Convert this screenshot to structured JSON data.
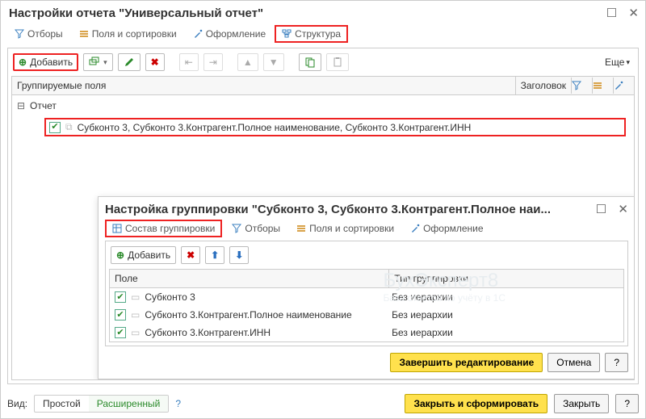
{
  "window": {
    "title": "Настройки отчета \"Универсальный отчет\"",
    "maximize_title": "Развернуть",
    "close_title": "Закрыть"
  },
  "tabs": {
    "filters": "Отборы",
    "fields": "Поля и сортировки",
    "style": "Оформление",
    "structure": "Структура"
  },
  "toolbar": {
    "add": "Добавить",
    "more": "Еще"
  },
  "columns": {
    "grouped_fields": "Группируемые поля",
    "header": "Заголовок"
  },
  "tree": {
    "root": "Отчет",
    "child": "Субконто 3, Субконто 3.Контрагент.Полное наименование, Субконто 3.Контрагент.ИНН"
  },
  "sub": {
    "title": "Настройка группировки \"Субконто 3, Субконто 3.Контрагент.Полное наи...",
    "tabs": {
      "composition": "Состав группировки",
      "filters": "Отборы",
      "fields": "Поля и сортировки",
      "style": "Оформление"
    },
    "toolbar": {
      "add": "Добавить"
    },
    "columns": {
      "field": "Поле",
      "group_type": "Тип группировки"
    },
    "rows": [
      {
        "field": "Субконто 3",
        "type": "Без иерархии"
      },
      {
        "field": "Субконто 3.Контрагент.Полное наименование",
        "type": "Без иерархии"
      },
      {
        "field": "Субконто 3.Контрагент.ИНН",
        "type": "Без иерархии"
      }
    ],
    "footer": {
      "finish": "Завершить редактирование",
      "cancel": "Отмена",
      "help": "?"
    }
  },
  "bottom": {
    "view_label": "Вид:",
    "simple": "Простой",
    "extended": "Расширенный",
    "help": "?",
    "close_form": "Закрыть и сформировать",
    "close": "Закрыть",
    "help2": "?"
  },
  "watermark": {
    "line1": "БухЭксперт8",
    "line2": "База ответов по учёту в 1С"
  }
}
